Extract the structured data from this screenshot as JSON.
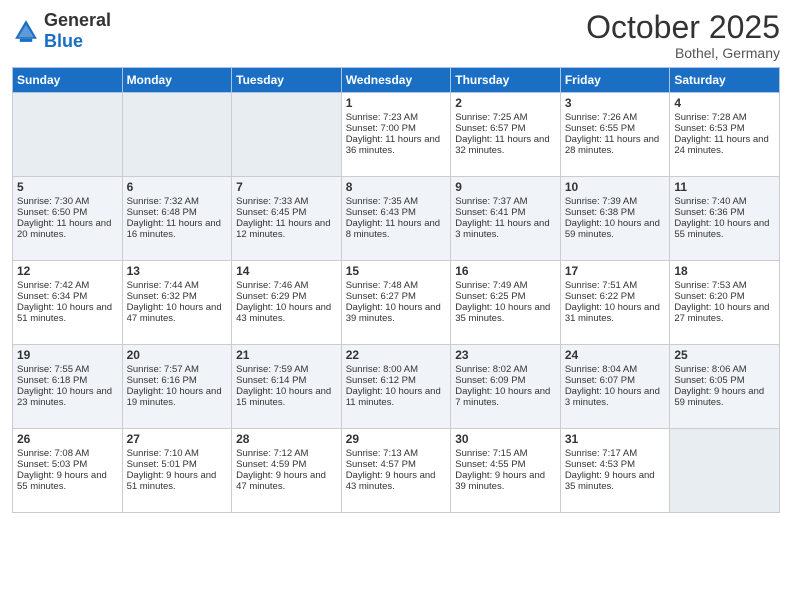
{
  "logo": {
    "general": "General",
    "blue": "Blue"
  },
  "title": "October 2025",
  "location": "Bothel, Germany",
  "days_of_week": [
    "Sunday",
    "Monday",
    "Tuesday",
    "Wednesday",
    "Thursday",
    "Friday",
    "Saturday"
  ],
  "weeks": [
    [
      {
        "day": "",
        "info": ""
      },
      {
        "day": "",
        "info": ""
      },
      {
        "day": "",
        "info": ""
      },
      {
        "day": "1",
        "info": "Sunrise: 7:23 AM\nSunset: 7:00 PM\nDaylight: 11 hours and 36 minutes."
      },
      {
        "day": "2",
        "info": "Sunrise: 7:25 AM\nSunset: 6:57 PM\nDaylight: 11 hours and 32 minutes."
      },
      {
        "day": "3",
        "info": "Sunrise: 7:26 AM\nSunset: 6:55 PM\nDaylight: 11 hours and 28 minutes."
      },
      {
        "day": "4",
        "info": "Sunrise: 7:28 AM\nSunset: 6:53 PM\nDaylight: 11 hours and 24 minutes."
      }
    ],
    [
      {
        "day": "5",
        "info": "Sunrise: 7:30 AM\nSunset: 6:50 PM\nDaylight: 11 hours and 20 minutes."
      },
      {
        "day": "6",
        "info": "Sunrise: 7:32 AM\nSunset: 6:48 PM\nDaylight: 11 hours and 16 minutes."
      },
      {
        "day": "7",
        "info": "Sunrise: 7:33 AM\nSunset: 6:45 PM\nDaylight: 11 hours and 12 minutes."
      },
      {
        "day": "8",
        "info": "Sunrise: 7:35 AM\nSunset: 6:43 PM\nDaylight: 11 hours and 8 minutes."
      },
      {
        "day": "9",
        "info": "Sunrise: 7:37 AM\nSunset: 6:41 PM\nDaylight: 11 hours and 3 minutes."
      },
      {
        "day": "10",
        "info": "Sunrise: 7:39 AM\nSunset: 6:38 PM\nDaylight: 10 hours and 59 minutes."
      },
      {
        "day": "11",
        "info": "Sunrise: 7:40 AM\nSunset: 6:36 PM\nDaylight: 10 hours and 55 minutes."
      }
    ],
    [
      {
        "day": "12",
        "info": "Sunrise: 7:42 AM\nSunset: 6:34 PM\nDaylight: 10 hours and 51 minutes."
      },
      {
        "day": "13",
        "info": "Sunrise: 7:44 AM\nSunset: 6:32 PM\nDaylight: 10 hours and 47 minutes."
      },
      {
        "day": "14",
        "info": "Sunrise: 7:46 AM\nSunset: 6:29 PM\nDaylight: 10 hours and 43 minutes."
      },
      {
        "day": "15",
        "info": "Sunrise: 7:48 AM\nSunset: 6:27 PM\nDaylight: 10 hours and 39 minutes."
      },
      {
        "day": "16",
        "info": "Sunrise: 7:49 AM\nSunset: 6:25 PM\nDaylight: 10 hours and 35 minutes."
      },
      {
        "day": "17",
        "info": "Sunrise: 7:51 AM\nSunset: 6:22 PM\nDaylight: 10 hours and 31 minutes."
      },
      {
        "day": "18",
        "info": "Sunrise: 7:53 AM\nSunset: 6:20 PM\nDaylight: 10 hours and 27 minutes."
      }
    ],
    [
      {
        "day": "19",
        "info": "Sunrise: 7:55 AM\nSunset: 6:18 PM\nDaylight: 10 hours and 23 minutes."
      },
      {
        "day": "20",
        "info": "Sunrise: 7:57 AM\nSunset: 6:16 PM\nDaylight: 10 hours and 19 minutes."
      },
      {
        "day": "21",
        "info": "Sunrise: 7:59 AM\nSunset: 6:14 PM\nDaylight: 10 hours and 15 minutes."
      },
      {
        "day": "22",
        "info": "Sunrise: 8:00 AM\nSunset: 6:12 PM\nDaylight: 10 hours and 11 minutes."
      },
      {
        "day": "23",
        "info": "Sunrise: 8:02 AM\nSunset: 6:09 PM\nDaylight: 10 hours and 7 minutes."
      },
      {
        "day": "24",
        "info": "Sunrise: 8:04 AM\nSunset: 6:07 PM\nDaylight: 10 hours and 3 minutes."
      },
      {
        "day": "25",
        "info": "Sunrise: 8:06 AM\nSunset: 6:05 PM\nDaylight: 9 hours and 59 minutes."
      }
    ],
    [
      {
        "day": "26",
        "info": "Sunrise: 7:08 AM\nSunset: 5:03 PM\nDaylight: 9 hours and 55 minutes."
      },
      {
        "day": "27",
        "info": "Sunrise: 7:10 AM\nSunset: 5:01 PM\nDaylight: 9 hours and 51 minutes."
      },
      {
        "day": "28",
        "info": "Sunrise: 7:12 AM\nSunset: 4:59 PM\nDaylight: 9 hours and 47 minutes."
      },
      {
        "day": "29",
        "info": "Sunrise: 7:13 AM\nSunset: 4:57 PM\nDaylight: 9 hours and 43 minutes."
      },
      {
        "day": "30",
        "info": "Sunrise: 7:15 AM\nSunset: 4:55 PM\nDaylight: 9 hours and 39 minutes."
      },
      {
        "day": "31",
        "info": "Sunrise: 7:17 AM\nSunset: 4:53 PM\nDaylight: 9 hours and 35 minutes."
      },
      {
        "day": "",
        "info": ""
      }
    ]
  ]
}
